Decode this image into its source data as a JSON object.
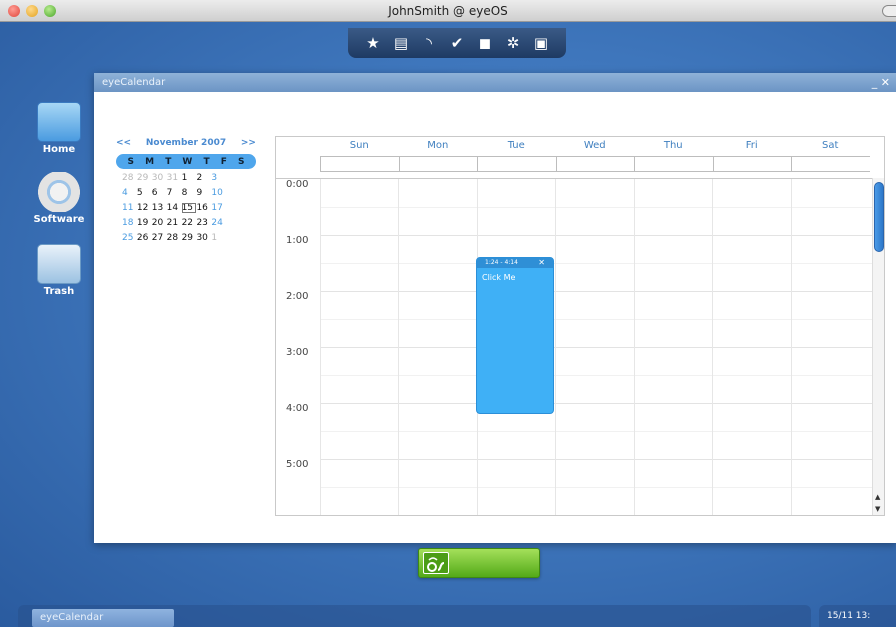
{
  "window_title": "JohnSmith @ eyeOS",
  "dock_icons": [
    "star-icon",
    "briefcase-icon",
    "rss-icon",
    "check-icon",
    "gamepad-icon",
    "gear-icon",
    "tray-icon"
  ],
  "desktop": {
    "icons": [
      {
        "name": "home",
        "label": "Home"
      },
      {
        "name": "software",
        "label": "Software"
      },
      {
        "name": "trash",
        "label": "Trash"
      }
    ]
  },
  "app": {
    "title": "eyeCalendar",
    "buttons": {
      "minimize": "_",
      "close": "✕"
    }
  },
  "mini_calendar": {
    "prev": "<<",
    "next": ">>",
    "month_label": "November 2007",
    "weekdays": [
      "S",
      "M",
      "T",
      "W",
      "T",
      "F",
      "S"
    ],
    "weeks": [
      [
        "28",
        "29",
        "30",
        "31",
        "1",
        "2",
        "3"
      ],
      [
        "4",
        "5",
        "6",
        "7",
        "8",
        "9",
        "10"
      ],
      [
        "11",
        "12",
        "13",
        "14",
        "15",
        "16",
        "17"
      ],
      [
        "18",
        "19",
        "20",
        "21",
        "22",
        "23",
        "24"
      ],
      [
        "25",
        "26",
        "27",
        "28",
        "29",
        "30",
        "1"
      ]
    ],
    "today": "15"
  },
  "week_view": {
    "days": [
      "Sun",
      "Mon",
      "Tue",
      "Wed",
      "Thu",
      "Fri",
      "Sat"
    ],
    "hours": [
      "0:00",
      "1:00",
      "2:00",
      "3:00",
      "4:00",
      "5:00"
    ],
    "event": {
      "time": "1:24 - 4:14",
      "title": "Click Me",
      "close": "✕",
      "day": "Tue"
    }
  },
  "taskbar": {
    "task": "eyeCalendar",
    "clock": "15/11   13:"
  },
  "colors": {
    "accent": "#3fb0f6",
    "header_text": "#3f7fbf",
    "logo_green": "#6bc22a"
  }
}
